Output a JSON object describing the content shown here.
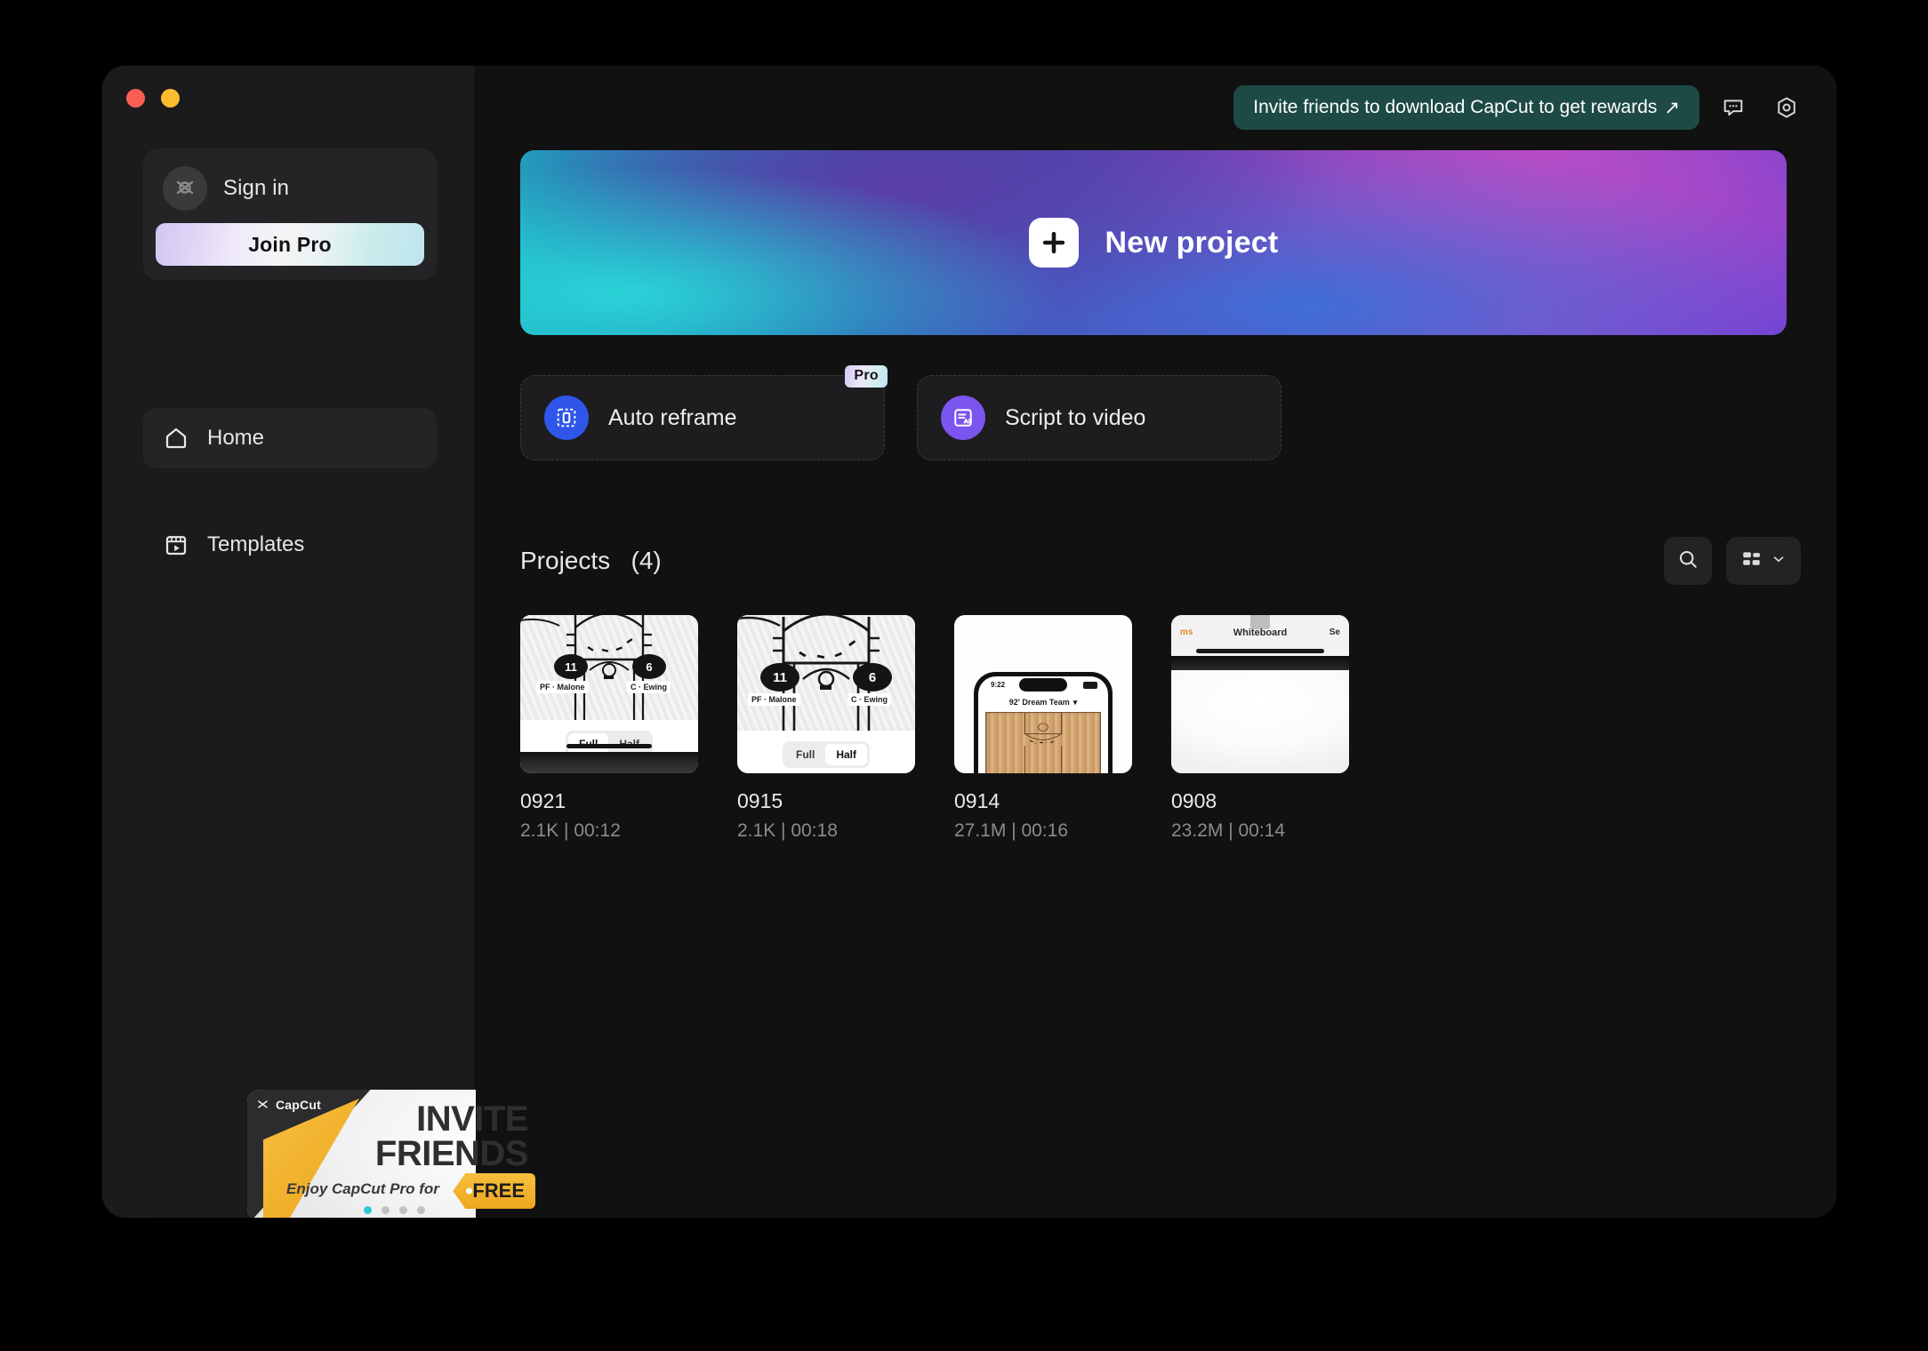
{
  "window": {
    "traffic_lights": [
      "close",
      "minimize"
    ]
  },
  "sidebar": {
    "account": {
      "signin_label": "Sign in",
      "avatar_icon": "capcut-logo-icon",
      "join_pro_label": "Join Pro"
    },
    "nav": [
      {
        "label": "Home",
        "icon": "home-icon",
        "active": true
      },
      {
        "label": "Templates",
        "icon": "templates-icon",
        "active": false
      }
    ],
    "promo": {
      "logo_text": "CapCut",
      "headline_line1": "INVITE",
      "headline_line2": "FRIENDS",
      "subtext": "Enjoy CapCut Pro for",
      "tag_text": "FREE",
      "dots_total": 4,
      "dot_active_index": 0,
      "dot_active_color": "#2ec8d8"
    }
  },
  "header": {
    "invite_banner": {
      "label": "Invite friends to download CapCut to get rewards",
      "arrow": "↗",
      "background": "#1d4a45"
    },
    "feedback_icon": "chat-bubble-icon",
    "settings_icon": "gear-hexagon-icon"
  },
  "main": {
    "new_project": {
      "label": "New project",
      "icon": "plus-icon"
    },
    "actions": [
      {
        "label": "Auto reframe",
        "icon": "auto-reframe-icon",
        "icon_color": "#2f56e8",
        "badge": "Pro"
      },
      {
        "label": "Script to video",
        "icon": "script-to-video-ai-icon",
        "icon_color": "#7c54f0",
        "badge": ""
      }
    ],
    "projects": {
      "title": "Projects",
      "count_label": "(4)",
      "search_icon": "search-icon",
      "view_icon": "grid-view-icon",
      "view_chevron_icon": "chevron-down-icon",
      "items": [
        {
          "name": "0921",
          "meta": "2.1K | 00:12",
          "thumb": {
            "type": "court-play",
            "players": [
              {
                "number": "11",
                "label": "PF · Malone"
              },
              {
                "number": "6",
                "label": "C · Ewing"
              }
            ],
            "segments": [
              "Full",
              "Half"
            ],
            "selected_segment": "Full"
          }
        },
        {
          "name": "0915",
          "meta": "2.1K | 00:18",
          "thumb": {
            "type": "court-play",
            "players": [
              {
                "number": "11",
                "label": "PF · Malone"
              },
              {
                "number": "6",
                "label": "C · Ewing"
              }
            ],
            "segments": [
              "Full",
              "Half"
            ],
            "selected_segment": "Half"
          }
        },
        {
          "name": "0914",
          "meta": "27.1M | 00:16",
          "thumb": {
            "type": "phone-mockup",
            "status_time": "9:22",
            "screen_title": "92' Dream Team"
          }
        },
        {
          "name": "0908",
          "meta": "23.2M | 00:14",
          "thumb": {
            "type": "whiteboard",
            "title": "Whiteboard",
            "left_action": "ms",
            "right_action": "Se"
          }
        }
      ]
    }
  }
}
